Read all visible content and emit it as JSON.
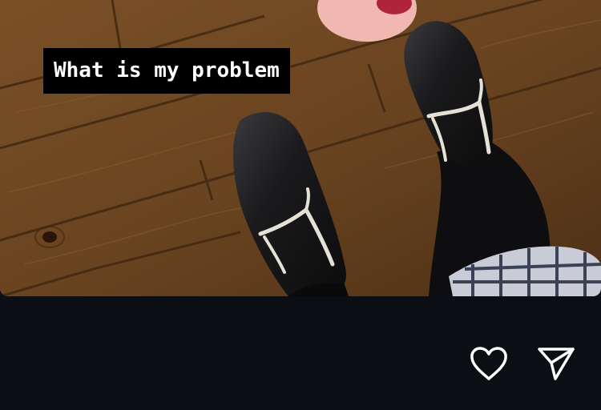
{
  "story": {
    "caption": "What is my problem",
    "image_alt": "Looking down at black loafers with white stitching on a wooden floor, plaid skirt hem and a finger with red nail polish at top"
  },
  "actions": {
    "like_icon": "heart-icon",
    "share_icon": "send-icon"
  },
  "colors": {
    "background": "#0b0f14",
    "caption_bg": "#000000",
    "caption_text": "#ffffff",
    "icon": "#ffffff"
  }
}
